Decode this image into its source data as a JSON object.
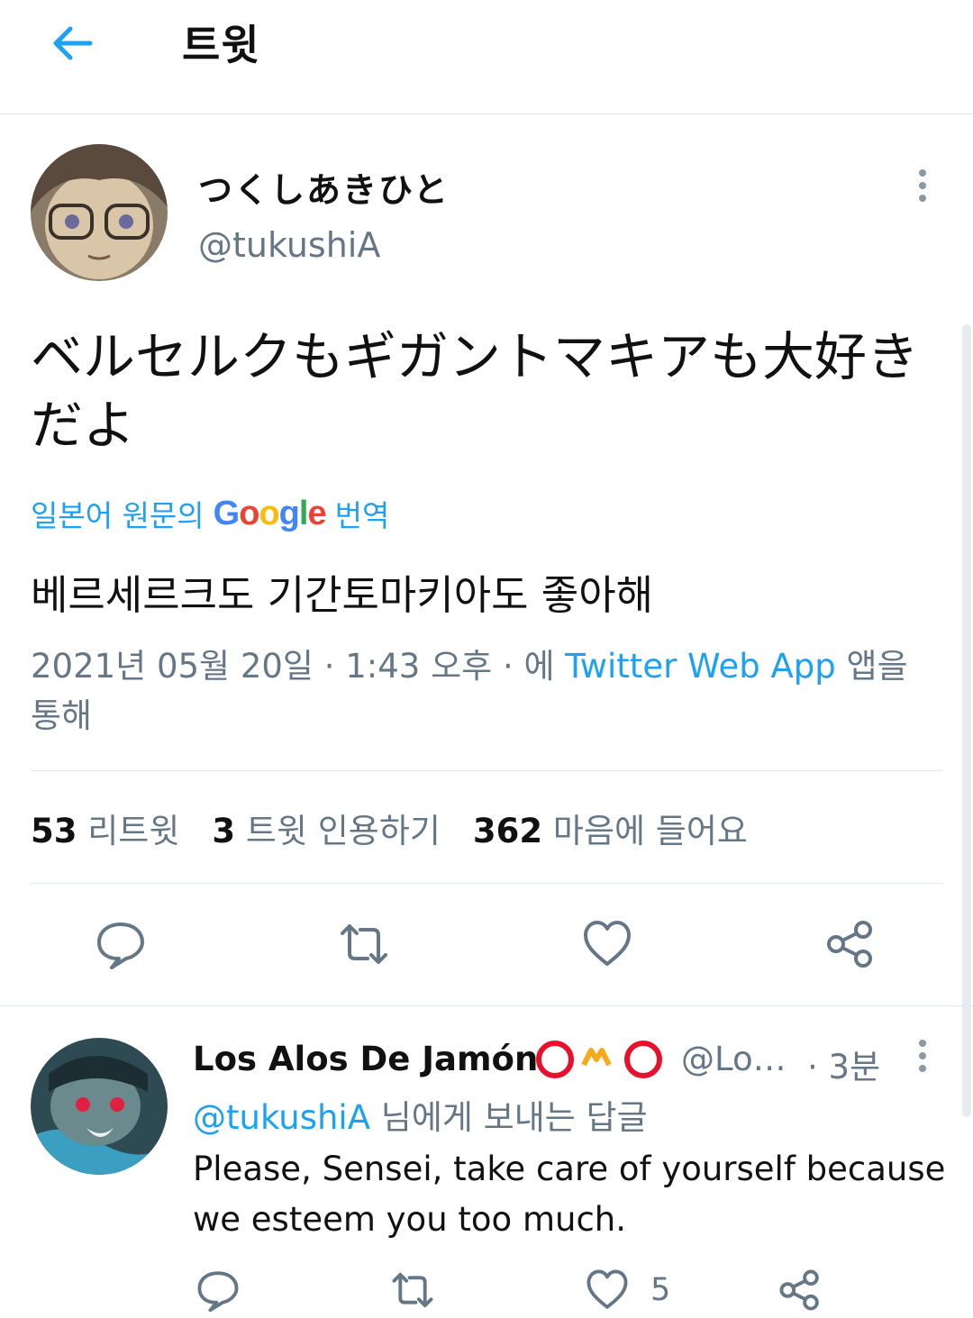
{
  "header": {
    "title": "트윗"
  },
  "tweet": {
    "display_name": "つくしあきひと",
    "handle": "@tukushiA",
    "text": "ベルセルクもギガントマキアも大好きだよ",
    "translate_prefix": "일본어 원문의",
    "translate_google": "Google",
    "translate_suffix": "번역",
    "translation": "베르세르크도 기간토마키아도 좋아해",
    "meta_date": "2021년 05월 20일 · 1:43 오후 · 에",
    "meta_source": "Twitter Web App",
    "meta_suffix": "앱을 통해",
    "stats": {
      "retweets_count": "53",
      "retweets_label": "리트윗",
      "quotes_count": "3",
      "quotes_label": "트윗 인용하기",
      "likes_count": "362",
      "likes_label": "마음에 들어요"
    }
  },
  "reply": {
    "display_name": "Los Alos De Jamón",
    "handle": "@Lo…",
    "time": "· 3분",
    "reply_to_handle": "@tukushiA",
    "reply_to_suffix": "님에게 보내는 답글",
    "text": "Please, Sensei, take care of yourself because we esteem you too much.",
    "like_count": "5"
  },
  "colors": {
    "accent": "#1da1f2",
    "muted": "#657786",
    "divider": "#e1e8ed"
  },
  "icons": [
    "back-arrow-icon",
    "more-vertical-icon",
    "reply-icon",
    "retweet-icon",
    "like-icon",
    "share-icon"
  ]
}
